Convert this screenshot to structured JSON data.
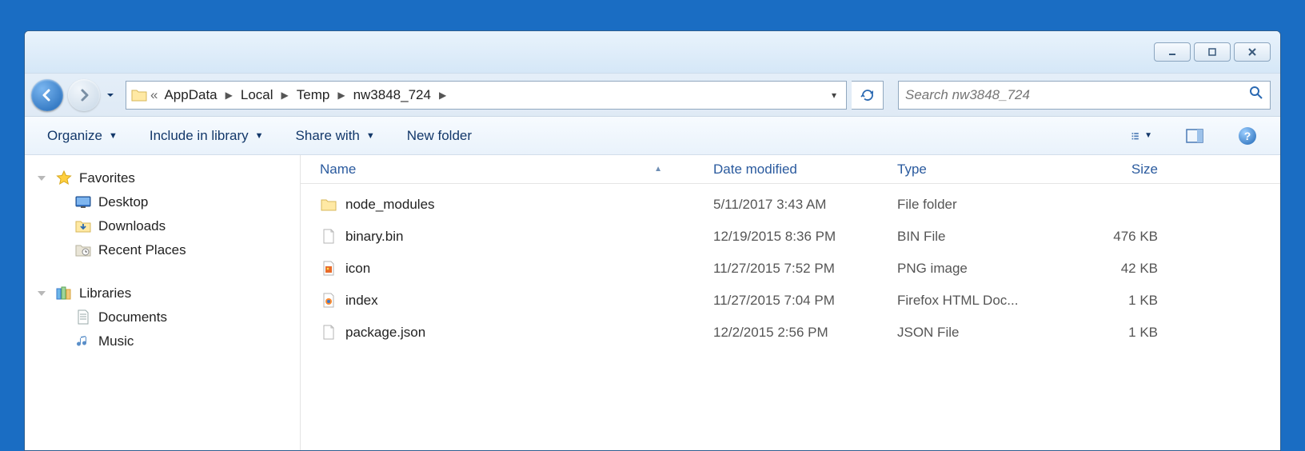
{
  "breadcrumb": {
    "prefix": "«",
    "items": [
      "AppData",
      "Local",
      "Temp",
      "nw3848_724"
    ]
  },
  "search": {
    "placeholder": "Search nw3848_724"
  },
  "toolbar": {
    "organize": "Organize",
    "include": "Include in library",
    "share": "Share with",
    "newfolder": "New folder"
  },
  "sidebar": {
    "favorites": {
      "label": "Favorites",
      "items": [
        {
          "label": "Desktop",
          "icon": "desktop"
        },
        {
          "label": "Downloads",
          "icon": "downloads"
        },
        {
          "label": "Recent Places",
          "icon": "recent"
        }
      ]
    },
    "libraries": {
      "label": "Libraries",
      "items": [
        {
          "label": "Documents",
          "icon": "documents"
        },
        {
          "label": "Music",
          "icon": "music"
        }
      ]
    }
  },
  "columns": {
    "name": "Name",
    "date": "Date modified",
    "type": "Type",
    "size": "Size"
  },
  "files": [
    {
      "name": "node_modules",
      "date": "5/11/2017 3:43 AM",
      "type": "File folder",
      "size": "",
      "icon": "folder"
    },
    {
      "name": "binary.bin",
      "date": "12/19/2015 8:36 PM",
      "type": "BIN File",
      "size": "476 KB",
      "icon": "blank"
    },
    {
      "name": "icon",
      "date": "11/27/2015 7:52 PM",
      "type": "PNG image",
      "size": "42 KB",
      "icon": "png"
    },
    {
      "name": "index",
      "date": "11/27/2015 7:04 PM",
      "type": "Firefox HTML Doc...",
      "size": "1 KB",
      "icon": "html"
    },
    {
      "name": "package.json",
      "date": "12/2/2015 2:56 PM",
      "type": "JSON File",
      "size": "1 KB",
      "icon": "blank"
    }
  ]
}
